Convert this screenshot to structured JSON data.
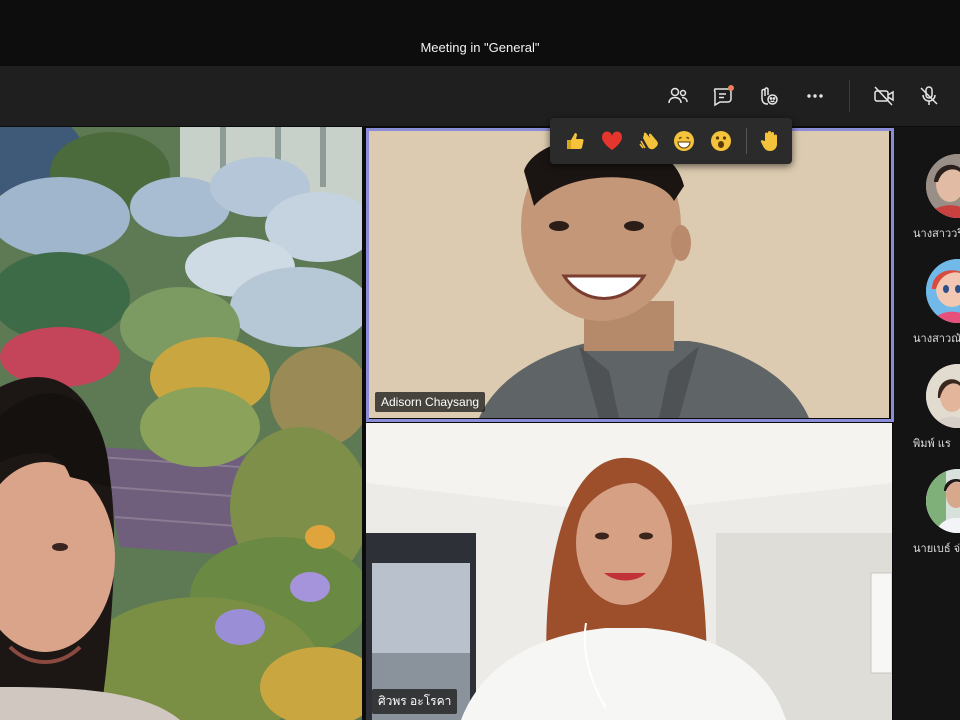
{
  "window": {
    "title": "Meeting in \"General\""
  },
  "toolbar": {
    "buttons": [
      {
        "icon": "participants-icon"
      },
      {
        "icon": "chat-icon"
      },
      {
        "icon": "reactions-icon"
      },
      {
        "icon": "more-icon"
      },
      {
        "icon": "camera-off-icon"
      },
      {
        "icon": "mic-off-icon"
      }
    ],
    "chat_badge_color": "#e8805b"
  },
  "reactions": [
    {
      "emoji": "👍",
      "name": "like"
    },
    {
      "emoji": "❤",
      "name": "heart"
    },
    {
      "emoji": "👏",
      "name": "applause"
    },
    {
      "emoji": "😁",
      "name": "laugh"
    },
    {
      "emoji": "😮",
      "name": "surprised"
    },
    {
      "emoji": "✋",
      "name": "raise-hand"
    }
  ],
  "videos": {
    "adisorn": {
      "name": "Adisorn Chaysang"
    },
    "siwaporn": {
      "name": "ศิวพร อะโรคา"
    }
  },
  "sidebar": {
    "participants": [
      {
        "name": "นางสาววริ"
      },
      {
        "name": "นางสาวณั"
      },
      {
        "name": "พิมพ์ แร"
      },
      {
        "name": "นายเบธ์ จ่"
      }
    ]
  },
  "colors": {
    "active_speaker_border": "#8b8cd8",
    "toolbar_bg": "#1f1f1f"
  }
}
